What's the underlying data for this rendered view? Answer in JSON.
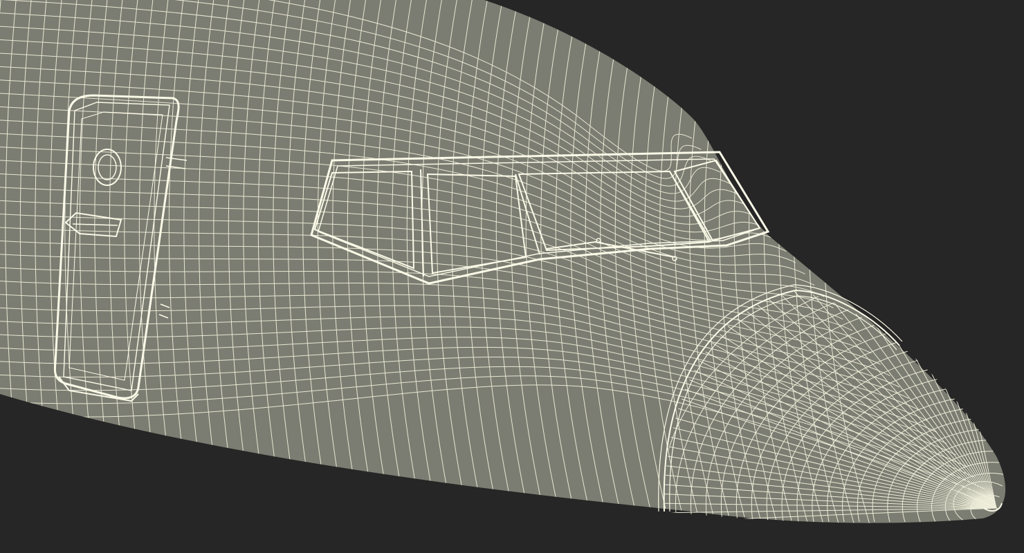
{
  "scene": {
    "subject": "aircraft-nose-wireframe",
    "colors": {
      "background": "#262626",
      "surface": "#7c7d72",
      "wire": "#f4f3df",
      "frame": "#fbfae8"
    }
  }
}
